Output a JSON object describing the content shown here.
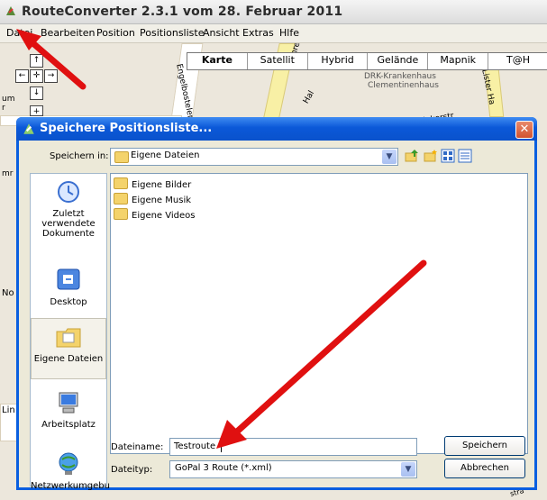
{
  "app": {
    "title": "RouteConverter 2.3.1 vom 28. Februar 2011",
    "icon": "route-converter-icon"
  },
  "menu": [
    "Datei",
    "Bearbeiten",
    "Position",
    "Positionsliste",
    "Ansicht",
    "Extras",
    "Hlfe"
  ],
  "map": {
    "types": [
      "Karte",
      "Satellit",
      "Hybrid",
      "Gelände",
      "Mapnik",
      "T@H"
    ],
    "active_type": "Karte",
    "labels": {
      "hospital_1": "DRK-Krankenhaus",
      "hospital_2": "Clementinenhaus",
      "street_1": "Engelbosteler D",
      "street_2": "Vahrenw",
      "street_3": "Hal",
      "street_4": "Lister Ha",
      "street_5": "Bödekerstr",
      "frag_1": "um",
      "frag_2": "r",
      "frag_3": "mr",
      "frag_4": "No",
      "frag_5": "Lin",
      "frag_6": "stra"
    }
  },
  "dialog": {
    "title": "Speichere Positionsliste...",
    "save_in_label": "Speichern in:",
    "save_in_value": "Eigene Dateien",
    "places": [
      {
        "label1": "Zuletzt",
        "label2": "verwendete",
        "label3": "Dokumente"
      },
      {
        "label1": "Desktop"
      },
      {
        "label1": "Eigene Dateien"
      },
      {
        "label1": "Arbeitsplatz"
      },
      {
        "label1": "Netzwerkumgebu"
      }
    ],
    "files": [
      "Eigene Bilder",
      "Eigene Musik",
      "Eigene Videos"
    ],
    "filename_label": "Dateiname:",
    "filename_value": "Testroute",
    "filetype_label": "Dateityp:",
    "filetype_value": "GoPal 3 Route (*.xml)",
    "save_button": "Speichern",
    "cancel_button": "Abbrechen",
    "close_glyph": "✕"
  },
  "colors": {
    "dialog_title": "#0a52cc",
    "annotation_arrow": "#e01010"
  }
}
